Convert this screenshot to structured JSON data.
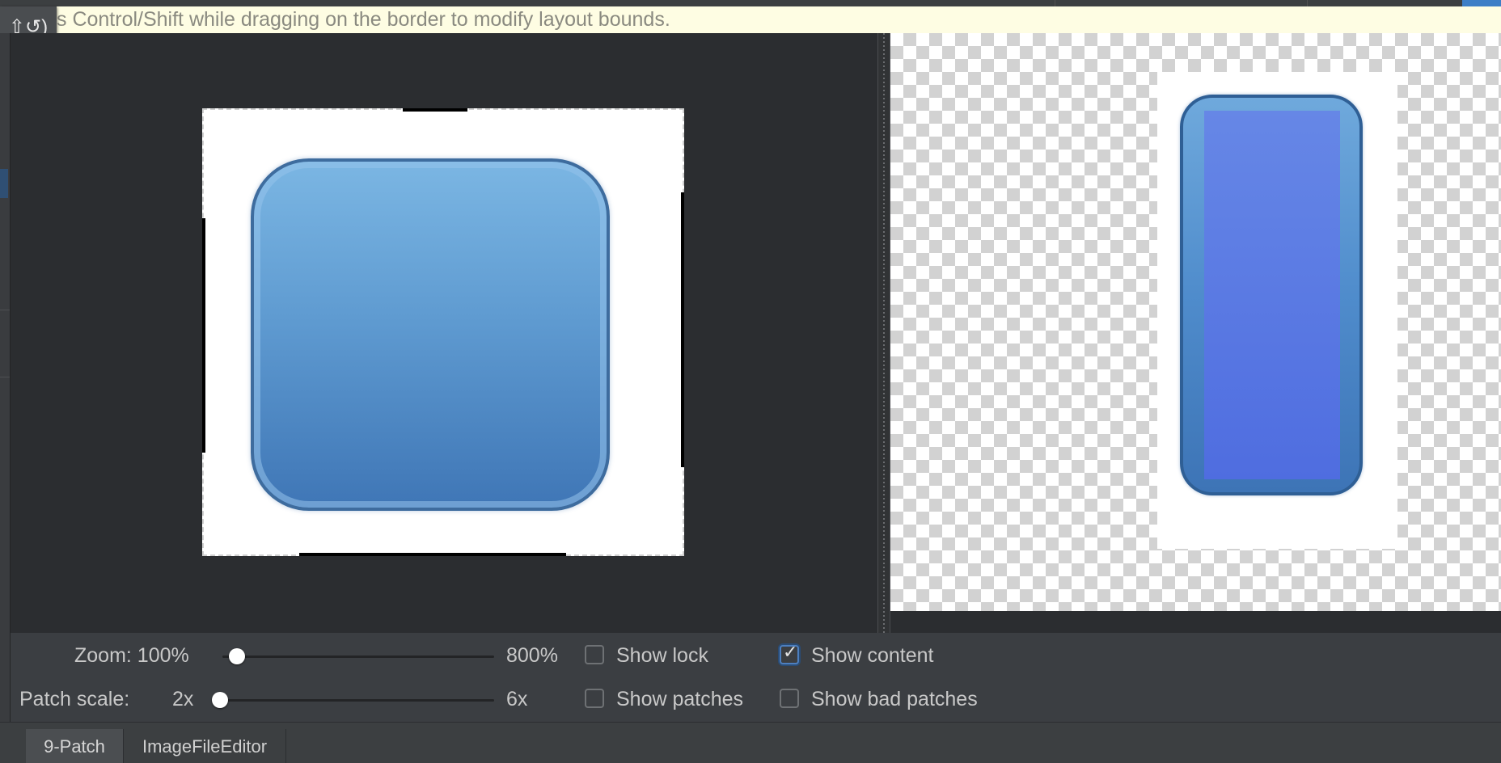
{
  "hint": {
    "text": "s Control/Shift while dragging on the border to modify layout bounds.",
    "undo_icon": "⇧↺)"
  },
  "controls": {
    "zoom_label": "Zoom: 100%",
    "zoom_max": "800%",
    "zoom_level": 0.03,
    "patch_scale_label": "Patch scale:",
    "patch_scale_min": "2x",
    "patch_scale_max": "6x",
    "patch_scale_value": 2,
    "show_lock": {
      "label": "Show lock",
      "checked": false
    },
    "show_content": {
      "label": "Show content",
      "checked": true
    },
    "show_patches": {
      "label": "Show patches",
      "checked": false
    },
    "show_bad_patches": {
      "label": "Show bad patches",
      "checked": false
    }
  },
  "tabs": [
    {
      "label": "9-Patch",
      "active": true
    },
    {
      "label": "ImageFileEditor",
      "active": false
    }
  ],
  "colors": {
    "hint_background": "#fefde3",
    "accent": "#3d7ec6",
    "preview_content": "#5573e2"
  }
}
